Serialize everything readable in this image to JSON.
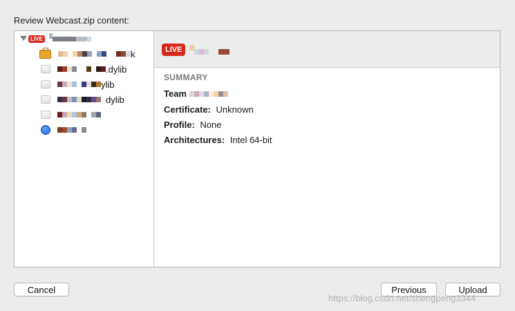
{
  "dialog": {
    "title": "Review Webcast.zip content:"
  },
  "tree": {
    "root_badge": "LIVE",
    "items": [
      {
        "icon": "briefcase-icon",
        "suffix": "k"
      },
      {
        "icon": "cube-icon",
        "suffix": ".dylib"
      },
      {
        "icon": "cube-icon",
        "suffix": "ylib"
      },
      {
        "icon": "cube-icon",
        "suffix": "dylib"
      },
      {
        "icon": "cube-icon",
        "suffix": ""
      },
      {
        "icon": "globe-icon",
        "suffix": ""
      }
    ]
  },
  "detail": {
    "badge": "LIVE",
    "summary_label": "SUMMARY",
    "team_label": "Team",
    "certificate_label": "Certificate:",
    "certificate_value": "Unknown",
    "profile_label": "Profile:",
    "profile_value": "None",
    "architectures_label": "Architectures:",
    "architectures_value": "Intel 64-bit"
  },
  "buttons": {
    "cancel": "Cancel",
    "previous": "Previous",
    "upload": "Upload"
  },
  "watermark": "https://blog.csdn.net/shengpeng3344",
  "colors": {
    "live_red": "#d72a1f",
    "background": "#ececec"
  }
}
